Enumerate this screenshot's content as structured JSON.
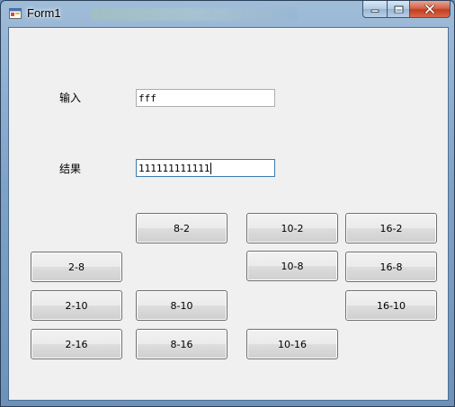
{
  "window": {
    "title": "Form1"
  },
  "form": {
    "input_label": "输入",
    "input_value": "fff",
    "result_label": "结果",
    "result_value": "111111111111"
  },
  "buttons": {
    "b8_2": "8-2",
    "b10_2": "10-2",
    "b16_2": "16-2",
    "b2_8": "2-8",
    "b10_8": "10-8",
    "b16_8": "16-8",
    "b2_10": "2-10",
    "b8_10": "8-10",
    "b16_10": "16-10",
    "b2_16": "2-16",
    "b8_16": "8-16",
    "b10_16": "10-16"
  },
  "colors": {
    "client_bg": "#f0f0f0",
    "close_button": "#c94a2b",
    "focus_border": "#3d7bad"
  },
  "icons": {
    "app": "form-app-icon",
    "minimize": "minimize-icon",
    "maximize": "maximize-icon",
    "close": "close-icon"
  }
}
